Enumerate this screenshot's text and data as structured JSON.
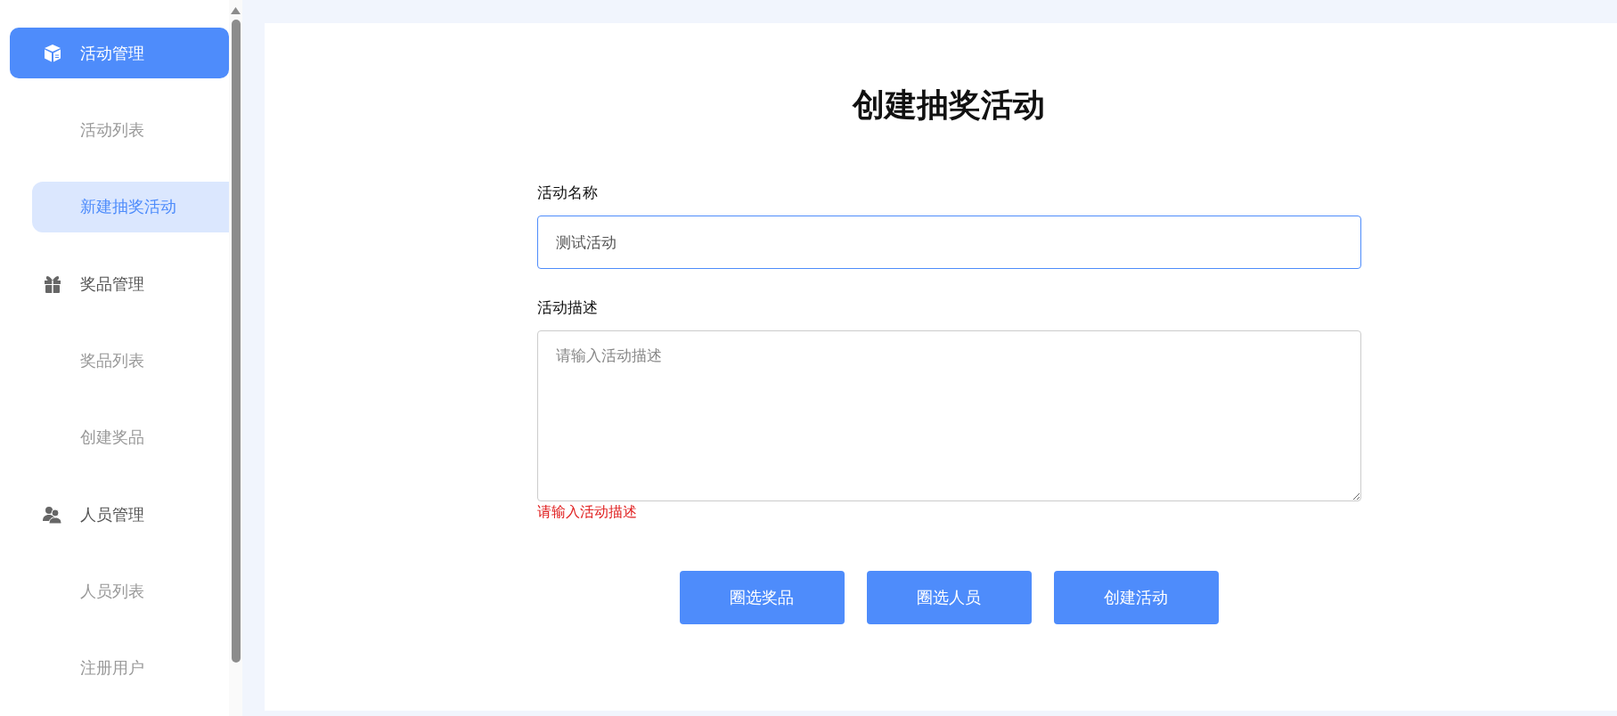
{
  "sidebar": {
    "groups": [
      {
        "label": "活动管理",
        "active": true,
        "items": [
          {
            "label": "活动列表",
            "selected": false
          },
          {
            "label": "新建抽奖活动",
            "selected": true
          }
        ]
      },
      {
        "label": "奖品管理",
        "active": false,
        "items": [
          {
            "label": "奖品列表",
            "selected": false
          },
          {
            "label": "创建奖品",
            "selected": false
          }
        ]
      },
      {
        "label": "人员管理",
        "active": false,
        "items": [
          {
            "label": "人员列表",
            "selected": false
          },
          {
            "label": "注册用户",
            "selected": false
          }
        ]
      }
    ]
  },
  "form": {
    "title": "创建抽奖活动",
    "fields": [
      {
        "kind": "input",
        "label": "活动名称",
        "value": "测试活动",
        "focused": true
      },
      {
        "kind": "textarea",
        "label": "活动描述",
        "placeholder": "请输入活动描述",
        "error": "请输入活动描述"
      }
    ],
    "buttons": [
      "圈选奖品",
      "圈选人员",
      "创建活动"
    ]
  }
}
